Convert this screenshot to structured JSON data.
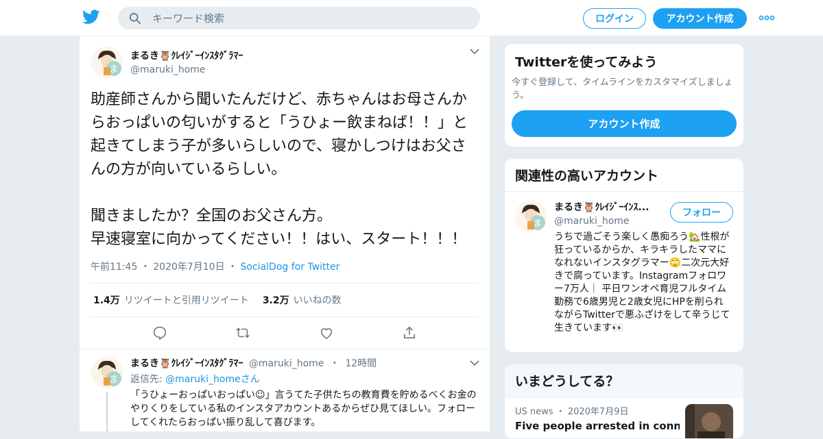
{
  "header": {
    "search_placeholder": "キーワード検索",
    "login_label": "ログイン",
    "signup_label": "アカウント作成"
  },
  "tweet": {
    "name": "まるき🦉ｸﾚｲｼﾞｰｲﾝｽﾀｸﾞﾗﾏｰ",
    "handle": "@maruki_home",
    "text": "助産師さんから聞いたんだけど、赤ちゃんはお母さんからおっぱいの匂いがすると「うひょー飲まねば！！」と起きてしまう子が多いらしいので、寝かしつけはお父さんの方が向いているらしい。\n\n聞きましたか？全国のお父さん方。\n早速寝室に向かってください！！はい、スタート！！！",
    "time": "午前11:45",
    "date": "2020年7月10日",
    "source": "SocialDog for Twitter",
    "retweets": "1.4万",
    "retweets_label": "リツイートと引用リツイート",
    "likes": "3.2万",
    "likes_label": "いいねの数"
  },
  "reply": {
    "name": "まるき🦉ｸﾚｲｼﾞｰｲﾝｽﾀｸﾞﾗﾏｰ",
    "handle": "@maruki_home",
    "age": "12時間",
    "reply_to_prefix": "返信先:",
    "reply_to_handle": "@maruki_homeさん",
    "text": "「うひょーおっぱいおっぱい☺」言うてた子供たちの教育費を貯めるべくお金のやりくりをしている私のインスタアカウントあるからぜひ見てほしい。フォローしてくれたらおっぱい振り乱して喜びます。"
  },
  "sidebar": {
    "try_title": "Twitterを使ってみよう",
    "try_desc": "今すぐ登録して、タイムラインをカスタマイズしましょう。",
    "try_button": "アカウント作成",
    "related_title": "関連性の高いアカウント",
    "related_name": "まるき🦉ｸﾚｲｼﾞｰｲﾝｽ...",
    "related_handle": "@maruki_home",
    "follow_label": "フォロー",
    "related_bio": "うちで過ごそう楽しく愚痴ろう🏡性根が狂っているからか、キラキラしたママになれないインスタグラマー🙄二次元大好きで腐っています。Instagramフォロワー7万人｜ 平日ワンオペ育児フルタイム勤務で6歳男児と2歳女児にHPを削られながらTwitterで悪ふざけをして辛うじて生きています👀",
    "trends_title": "いまどうしてる？",
    "news_category": "US news",
    "news_date": "2020年7月9日",
    "news_headline": "Five people arrested in connection"
  },
  "colors": {
    "brand": "#1da1f2",
    "link": "#1b95e0",
    "muted": "#657786",
    "background": "#e6ecf0"
  },
  "icons": [
    "twitter-bird-icon",
    "search-icon",
    "more-dots-icon",
    "chevron-down-icon",
    "reply-icon",
    "retweet-icon",
    "like-icon",
    "share-icon"
  ]
}
